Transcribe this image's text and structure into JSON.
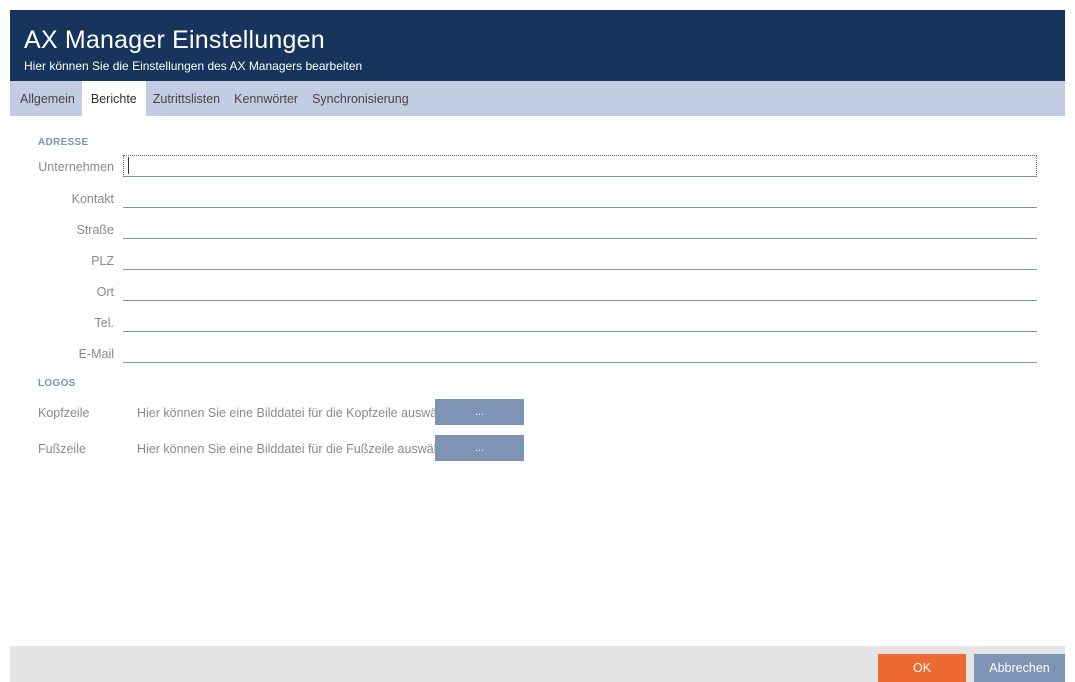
{
  "header": {
    "title": "AX Manager Einstellungen",
    "subtitle": "Hier können Sie die Einstellungen des AX Managers bearbeiten"
  },
  "tabs": [
    {
      "label": "Allgemein"
    },
    {
      "label": "Berichte",
      "active": true
    },
    {
      "label": "Zutrittslisten"
    },
    {
      "label": "Kennwörter"
    },
    {
      "label": "Synchronisierung"
    }
  ],
  "address": {
    "section_title": "ADRESSE",
    "fields": [
      {
        "label": "Unternehmen",
        "value": ""
      },
      {
        "label": "Kontakt",
        "value": ""
      },
      {
        "label": "Straße",
        "value": ""
      },
      {
        "label": "PLZ",
        "value": ""
      },
      {
        "label": "Ort",
        "value": ""
      },
      {
        "label": "Tel.",
        "value": ""
      },
      {
        "label": "E-Mail",
        "value": ""
      }
    ]
  },
  "logos": {
    "section_title": "LOGOS",
    "header_label": "Kopfzeile",
    "header_text": "Hier können Sie eine Bilddatei für die Kopfzeile auswählen",
    "header_button": "...",
    "footer_label": "Fußzeile",
    "footer_text": "Hier können Sie eine Bilddatei für die Fußzeile auswählen",
    "footer_button": "..."
  },
  "footer": {
    "ok_label": "OK",
    "cancel_label": "Abbrechen"
  },
  "colors": {
    "header_bg": "#17355c",
    "tab_bar_bg": "#c3cde2",
    "accent_blue": "#7f93b5",
    "ok_orange": "#ee6a33",
    "footer_bg": "#e4e4e4"
  }
}
